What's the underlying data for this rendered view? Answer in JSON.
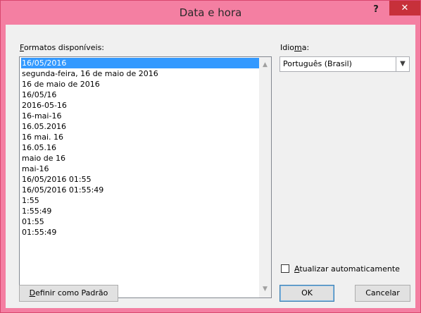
{
  "window": {
    "title": "Data e hora",
    "help_label": "?",
    "close_label": "✕"
  },
  "formats": {
    "label_mnemonic": "F",
    "label_rest": "ormatos disponíveis:",
    "items": [
      "16/05/2016",
      "segunda-feira, 16 de maio de 2016",
      "16 de maio de 2016",
      "16/05/16",
      "2016-05-16",
      "16-mai-16",
      "16.05.2016",
      "16 mai. 16",
      "16.05.16",
      "maio de 16",
      "mai-16",
      "16/05/2016 01:55",
      "16/05/2016 01:55:49",
      "1:55",
      "1:55:49",
      "01:55",
      "01:55:49"
    ],
    "selected_index": 0
  },
  "language": {
    "label_before": "Idio",
    "label_mnemonic": "m",
    "label_after": "a:",
    "value": "Português (Brasil)"
  },
  "auto_update": {
    "label_mnemonic": "A",
    "label_rest": "tualizar automaticamente",
    "checked": false
  },
  "buttons": {
    "set_default_mnemonic": "D",
    "set_default_rest": "efinir como Padrão",
    "ok": "OK",
    "cancel": "Cancelar"
  },
  "colors": {
    "titlebar": "#f47fa2",
    "close_button": "#c7303a",
    "selection": "#3399ff"
  }
}
